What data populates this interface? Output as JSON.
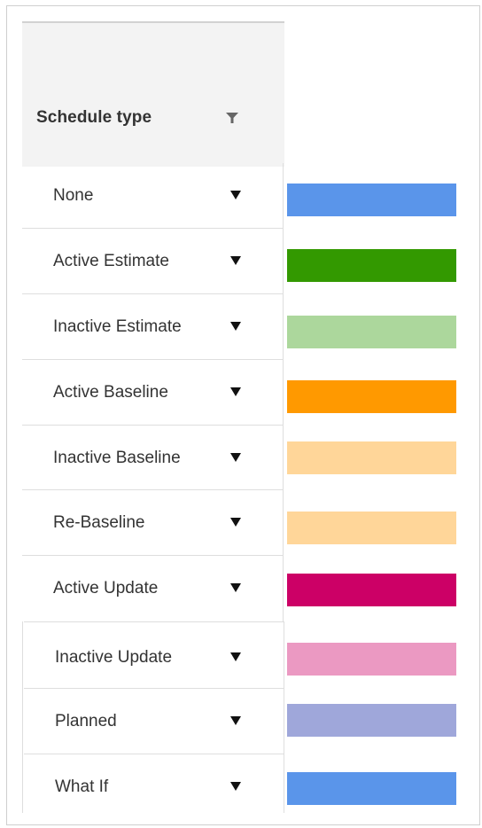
{
  "header": {
    "title": "Schedule type"
  },
  "rows": [
    {
      "label": "None",
      "color": "#5a95ea"
    },
    {
      "label": "Active Estimate",
      "color": "#339900"
    },
    {
      "label": "Inactive Estimate",
      "color": "#acd79c"
    },
    {
      "label": "Active Baseline",
      "color": "#ff9900"
    },
    {
      "label": "Inactive Baseline",
      "color": "#ffd699"
    },
    {
      "label": "Re-Baseline",
      "color": "#ffd699"
    },
    {
      "label": "Active Update",
      "color": "#cc0066"
    },
    {
      "label": "Inactive Update",
      "color": "#eb99c2"
    },
    {
      "label": "Planned",
      "color": "#9fa7da"
    },
    {
      "label": "What If",
      "color": "#5a95ea"
    }
  ]
}
